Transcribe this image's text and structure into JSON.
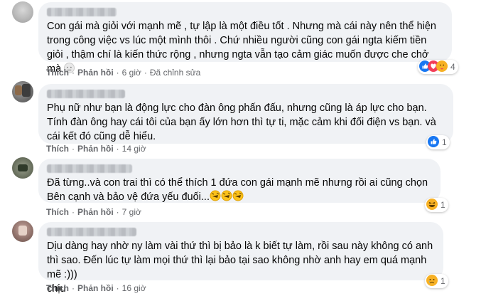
{
  "comments": [
    {
      "text": "Con gái mà giỏi với mạnh mẽ , tự lập là một điều tốt . Nhưng mà cái này nên thể hiện trong công việc vs lúc một mình thôi . Chứ nhiều người cũng con gái ngta kiếm tiền giỏi , thậm chí là kiến thức rộng , nhưng ngta vẫn tạo cảm giác muốn được che chở mà",
      "like": "Thích",
      "reply": "Phản hồi",
      "time": "6 giờ",
      "edited": "Đã chỉnh sửa",
      "reaction_count": "4",
      "reaction_icons": [
        "like-icon",
        "heart-icon",
        "care-icon"
      ]
    },
    {
      "text": "Phụ nữ như bạn là động lực cho đàn ông phấn đấu, nhưng cũng là áp lực cho bạn. Tính đàn ông hay cái tôi của bạn ấy lớn hơn thì tự ti, mặc cảm khi đối điện vs bạn. và cái kết đó cũng dễ hiểu.",
      "like": "Thích",
      "reply": "Phản hồi",
      "time": "14 giờ",
      "reaction_count": "1",
      "reaction_icons": [
        "like-icon"
      ]
    },
    {
      "text": "Đã từng..và con trai thì có thể thích 1 đứa con gái mạnh mẽ nhưng rồi ai cũng chọn Bên cạnh và bảo vệ đứa yếu đuối...",
      "like": "Thích",
      "reply": "Phản hồi",
      "time": "7 giờ",
      "reaction_count": "1",
      "reaction_icons": [
        "haha-icon"
      ]
    },
    {
      "text": "Dịu dàng hay nhờ ny làm vài thứ thì bị bảo là k biết tự làm, rồi sau này không có anh thì sao. Đến lúc tự làm mọi thứ thì lại bảo tại sao không nhờ anh hay em quá mạnh mẽ :)))\nchịu",
      "like": "Thích",
      "reply": "Phản hồi",
      "time": "16 giờ",
      "reaction_count": "1",
      "reaction_icons": [
        "sad-icon"
      ]
    }
  ]
}
